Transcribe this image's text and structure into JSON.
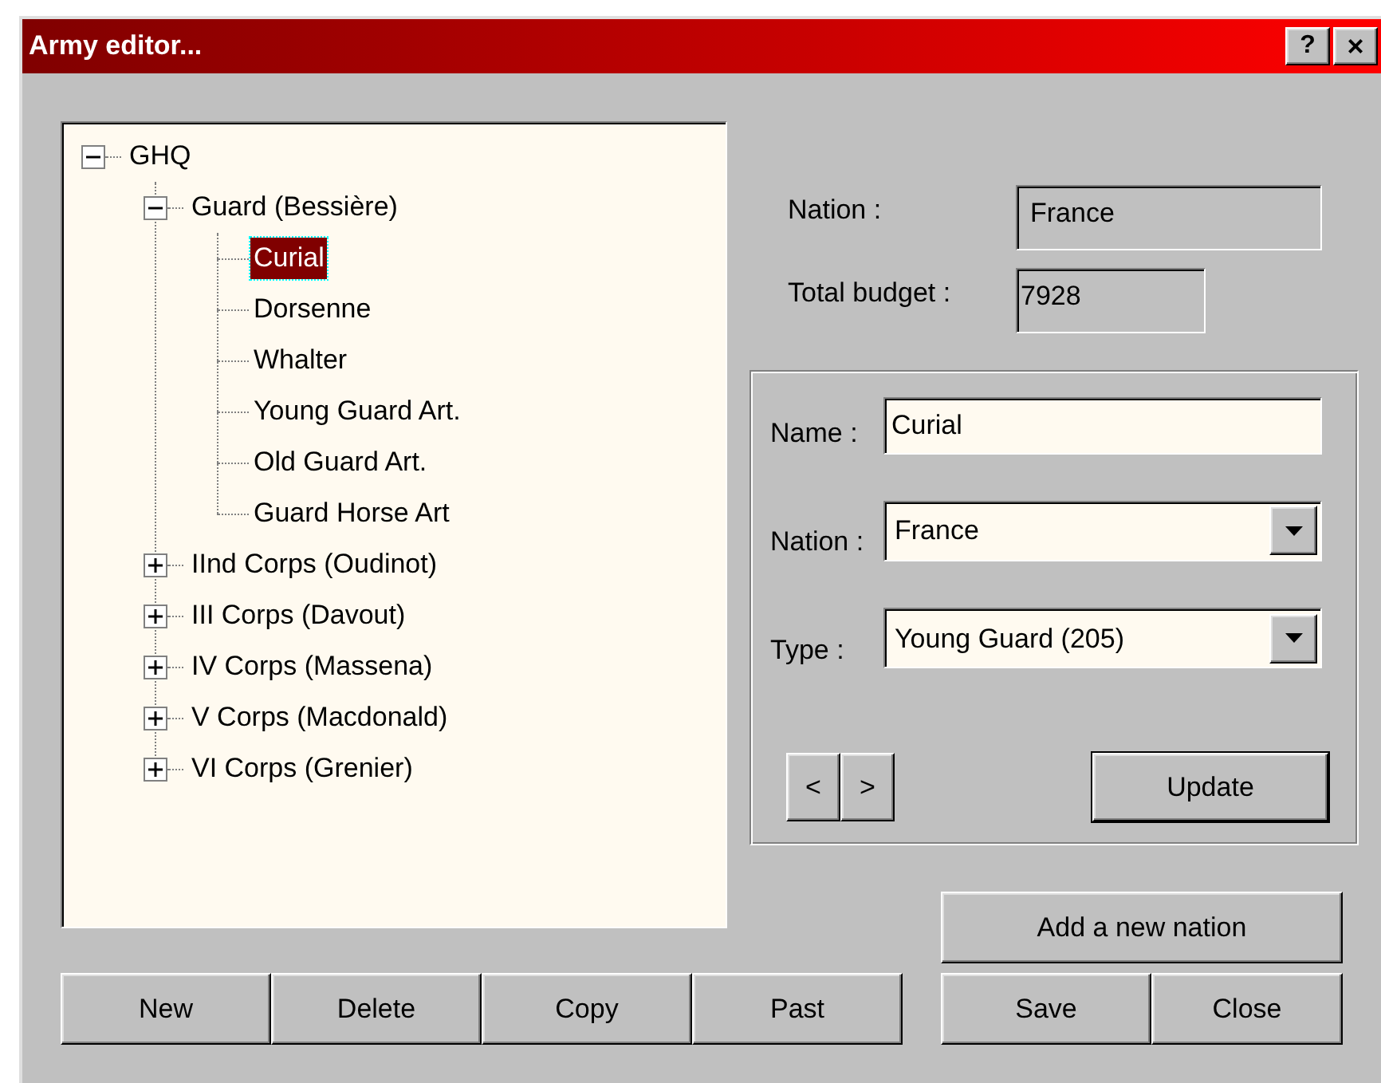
{
  "window": {
    "title": "Army editor...",
    "help_button": "?",
    "close_button": "×"
  },
  "tree": [
    {
      "label": "GHQ",
      "kind": "branch",
      "expanded": true,
      "selected": false,
      "children": [
        {
          "label": "Guard (Bessière)",
          "kind": "branch",
          "expanded": true,
          "selected": false,
          "children": [
            {
              "label": "Curial",
              "kind": "leaf",
              "selected": true
            },
            {
              "label": "Dorsenne",
              "kind": "leaf",
              "selected": false
            },
            {
              "label": "Whalter",
              "kind": "leaf",
              "selected": false
            },
            {
              "label": "Young Guard Art.",
              "kind": "leaf",
              "selected": false
            },
            {
              "label": "Old Guard Art.",
              "kind": "leaf",
              "selected": false
            },
            {
              "label": "Guard Horse Art",
              "kind": "leaf",
              "selected": false
            }
          ]
        },
        {
          "label": "IInd Corps (Oudinot)",
          "kind": "branch",
          "expanded": false,
          "selected": false
        },
        {
          "label": "III Corps (Davout)",
          "kind": "branch",
          "expanded": false,
          "selected": false
        },
        {
          "label": "IV Corps (Massena)",
          "kind": "branch",
          "expanded": false,
          "selected": false
        },
        {
          "label": "V Corps (Macdonald)",
          "kind": "branch",
          "expanded": false,
          "selected": false
        },
        {
          "label": "VI Corps (Grenier)",
          "kind": "branch",
          "expanded": false,
          "selected": false
        }
      ]
    }
  ],
  "tree_buttons": [
    {
      "label": "New"
    },
    {
      "label": "Delete"
    },
    {
      "label": "Copy"
    },
    {
      "label": "Past"
    }
  ],
  "info": {
    "nation": {
      "label": "Nation :",
      "value": "France"
    },
    "total_budget": {
      "label": "Total budget :",
      "value": "7928"
    }
  },
  "form": {
    "name": {
      "label": "Name :",
      "value": "Curial"
    },
    "nation": {
      "label": "Nation :",
      "value": "France"
    },
    "type": {
      "label": "Type :",
      "value": "Young Guard (205)"
    },
    "prev_button": "<",
    "next_button": ">",
    "update_button": {
      "label": "Update"
    }
  },
  "add_nation_button": {
    "label": "Add a new nation"
  },
  "dialog_buttons": [
    {
      "label": "Save"
    },
    {
      "label": "Close"
    }
  ]
}
